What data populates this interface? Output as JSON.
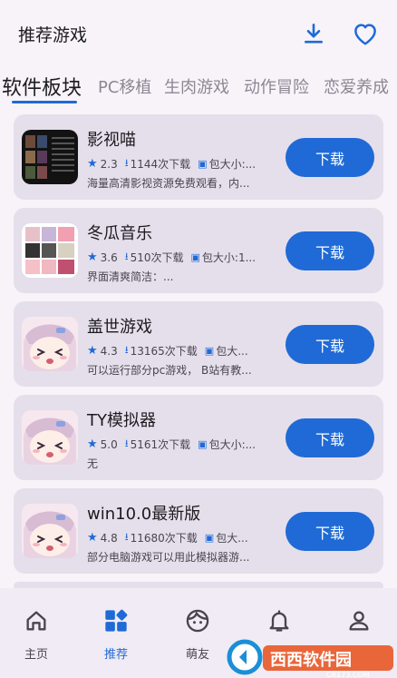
{
  "header": {
    "title": "推荐游戏",
    "download_icon": "download-icon",
    "favorite_icon": "heart-icon"
  },
  "tabs": [
    {
      "label": "软件板块",
      "active": true
    },
    {
      "label": "PC移植",
      "active": false
    },
    {
      "label": "生肉游戏",
      "active": false
    },
    {
      "label": "动作冒险",
      "active": false
    },
    {
      "label": "恋爱养成",
      "active": false
    }
  ],
  "apps": [
    {
      "name": "影视喵",
      "rating": "2.3",
      "downloads": "1144次下载",
      "size": "包大小:...",
      "desc": "海量高清影视资源免费观看，内...",
      "button": "下载"
    },
    {
      "name": "冬瓜音乐",
      "rating": "3.6",
      "downloads": "510次下载",
      "size": "包大小:1...",
      "desc": "界面清爽简洁：...",
      "button": "下载"
    },
    {
      "name": "盖世游戏",
      "rating": "4.3",
      "downloads": "13165次下载",
      "size": "包大...",
      "desc": "可以运行部分pc游戏，  B站有教...",
      "button": "下载"
    },
    {
      "name": "TY模拟器",
      "rating": "5.0",
      "downloads": "5161次下载",
      "size": "包大小:...",
      "desc": "无",
      "button": "下载"
    },
    {
      "name": "win10.0最新版",
      "rating": "4.8",
      "downloads": "11680次下载",
      "size": "包大...",
      "desc": "部分电脑游戏可以用此模拟器游...",
      "button": "下载"
    }
  ],
  "nav": [
    {
      "label": "主页",
      "icon": "home-icon",
      "active": false
    },
    {
      "label": "推荐",
      "icon": "grid-icon",
      "active": true
    },
    {
      "label": "萌友",
      "icon": "face-icon",
      "active": false
    },
    {
      "label": "",
      "icon": "bell-icon",
      "active": false
    },
    {
      "label": "",
      "icon": "person-icon",
      "active": false
    }
  ],
  "watermark": {
    "text": "西西软件园",
    "sub": "CR173.COM"
  },
  "colors": {
    "accent": "#1f6ad6",
    "card": "#e5dfeb",
    "background": "#f7f3f9"
  }
}
